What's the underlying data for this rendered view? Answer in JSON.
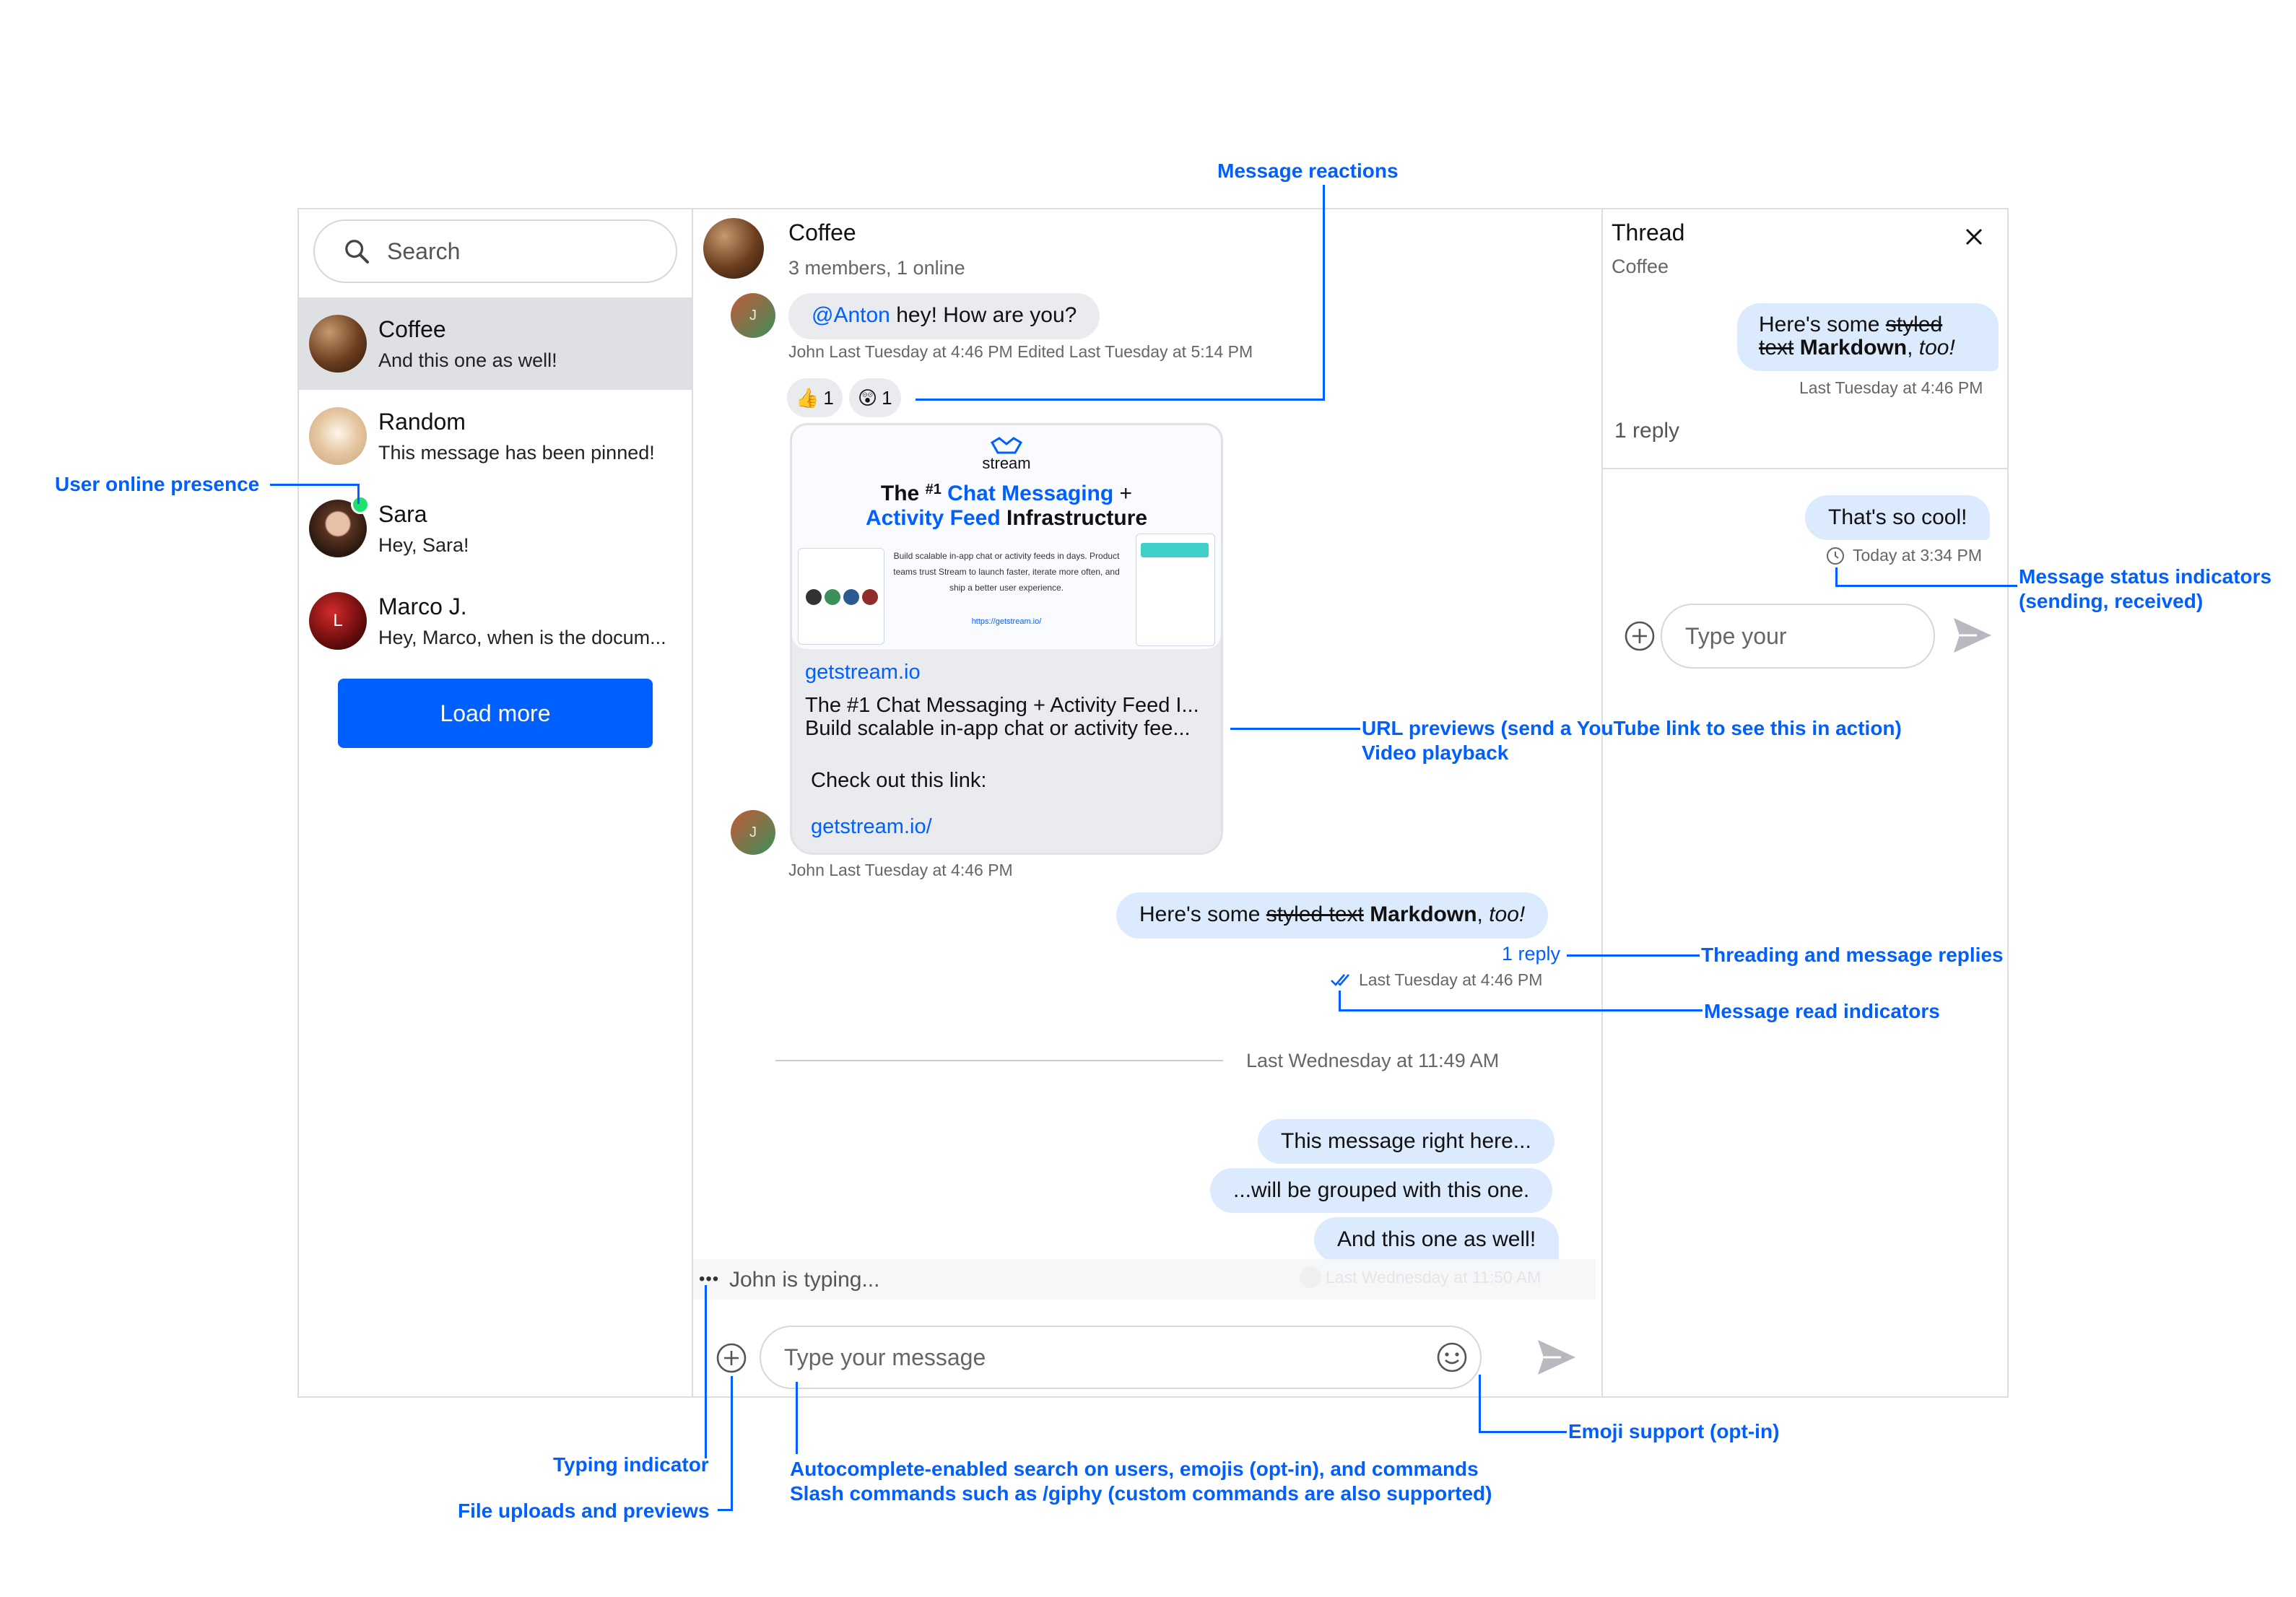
{
  "sidebar": {
    "search_placeholder": "Search",
    "channels": [
      {
        "name": "Coffee",
        "last_message": "And this one as well!",
        "avatar": "coffee-beans-image"
      },
      {
        "name": "Random",
        "last_message": "This message has been pinned!",
        "avatar": "latte-art-image"
      },
      {
        "name": "Sara",
        "last_message": "Hey, Sara!",
        "avatar": "sara-photo"
      },
      {
        "name": "Marco J.",
        "last_message": "Hey, Marco, when is the docum...",
        "avatar_initial": "L"
      }
    ],
    "load_more_label": "Load more"
  },
  "channel_header": {
    "title": "Coffee",
    "subtitle": "3 members, 1 online"
  },
  "messages": {
    "m1": {
      "avatar_initial": "J",
      "mention": "@Anton",
      "text": " hey! How are you?",
      "meta": "John Last Tuesday at 4:46 PM Edited Last Tuesday at 5:14 PM",
      "reactions": [
        {
          "emoji": "👍",
          "count": "1"
        },
        {
          "emoji": "😲",
          "count": "1"
        }
      ]
    },
    "preview": {
      "image": {
        "brand": "stream",
        "headline_pre": "The ",
        "headline_num": "#1",
        "headline_blue1": "Chat Messaging",
        "headline_plus": " +",
        "headline_blue2": "Activity Feed",
        "headline_post": " Infrastructure",
        "body": "Build scalable in-app chat or activity feeds in days. Product teams trust Stream to launch faster, iterate more often, and ship a better user experience.",
        "url": "https://getstream.io/"
      },
      "domain": "getstream.io",
      "title": "The #1 Chat Messaging + Activity Feed I...",
      "description": "Build scalable in-app chat or activity fee...",
      "text": "Check out this link:",
      "link": "getstream.io/",
      "avatar_initial": "J",
      "meta": "John Last Tuesday at 4:46 PM"
    },
    "m3": {
      "pre": "Here's some ",
      "strike": "styled text",
      "bold": "Markdown",
      "italic": "too!",
      "reply_count": "1 reply",
      "meta": "Last Tuesday at 4:46 PM"
    },
    "date_separator": "Last Wednesday at 11:49 AM",
    "group": [
      "This message right here...",
      "...will be grouped with this one.",
      "And this one as well!"
    ],
    "group_meta": "Last Wednesday at 11:50 AM",
    "typing": "John is typing..."
  },
  "composer": {
    "placeholder": "Type your message"
  },
  "thread": {
    "title": "Thread",
    "subtitle": "Coffee",
    "parent": {
      "pre": "Here's some ",
      "strike1": "styled",
      "strike2": "text",
      "bold": "Markdown",
      "italic": "too!",
      "meta": "Last Tuesday at 4:46 PM"
    },
    "reply_count": "1 reply",
    "reply": {
      "text": "That's so cool!",
      "meta": "Today at 3:34 PM"
    },
    "composer_placeholder": "Type your"
  },
  "annotations": {
    "reactions": "Message reactions",
    "presence": "User online presence",
    "status_1": "Message status indicators",
    "status_2": "(sending, received)",
    "url_1": "URL previews (send a YouTube link to see this in action)",
    "url_2": "Video playback",
    "threading": "Threading and message replies",
    "read": "Message read indicators",
    "emoji": "Emoji support (opt-in)",
    "typing": "Typing indicator",
    "uploads": "File uploads and previews",
    "autocomplete_1": "Autocomplete-enabled search on users, emojis (opt-in), and commands",
    "autocomplete_2": "Slash commands such as /giphy (custom commands are also supported)"
  },
  "colors": {
    "accent": "#005fff",
    "online": "#20e070",
    "bubble": "#e9ebef",
    "my_bubble": "#dbeafd"
  }
}
